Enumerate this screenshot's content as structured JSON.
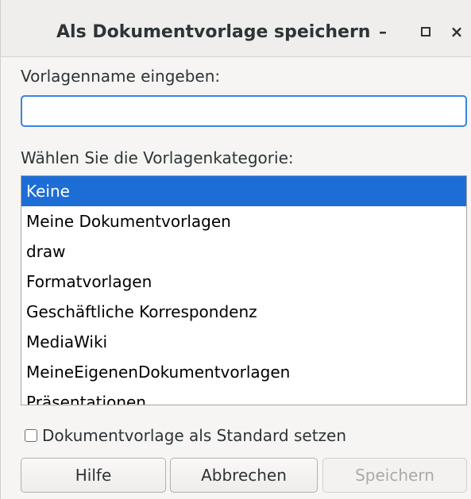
{
  "window": {
    "title": "Als Dokumentvorlage speichern",
    "controls": {
      "minimize": "–",
      "close": "×"
    }
  },
  "name_field": {
    "label": "Vorlagenname eingeben:",
    "value": "",
    "placeholder": ""
  },
  "category": {
    "label": "Wählen Sie die Vorlagenkategorie:",
    "items": [
      "Keine",
      "Meine Dokumentvorlagen",
      "draw",
      "Formatvorlagen",
      "Geschäftliche Korrespondenz",
      "MediaWiki",
      "MeineEigenenDokumentvorlagen",
      "Präsentationen"
    ],
    "selected": "Keine"
  },
  "default_checkbox": {
    "label": "Dokumentvorlage als Standard setzen",
    "checked": false
  },
  "buttons": {
    "help": "Hilfe",
    "cancel": "Abbrechen",
    "save": "Speichern"
  },
  "colors": {
    "selection": "#1c6ed6",
    "focus": "#3584e4",
    "disabled_text": "#a8aaa9"
  }
}
